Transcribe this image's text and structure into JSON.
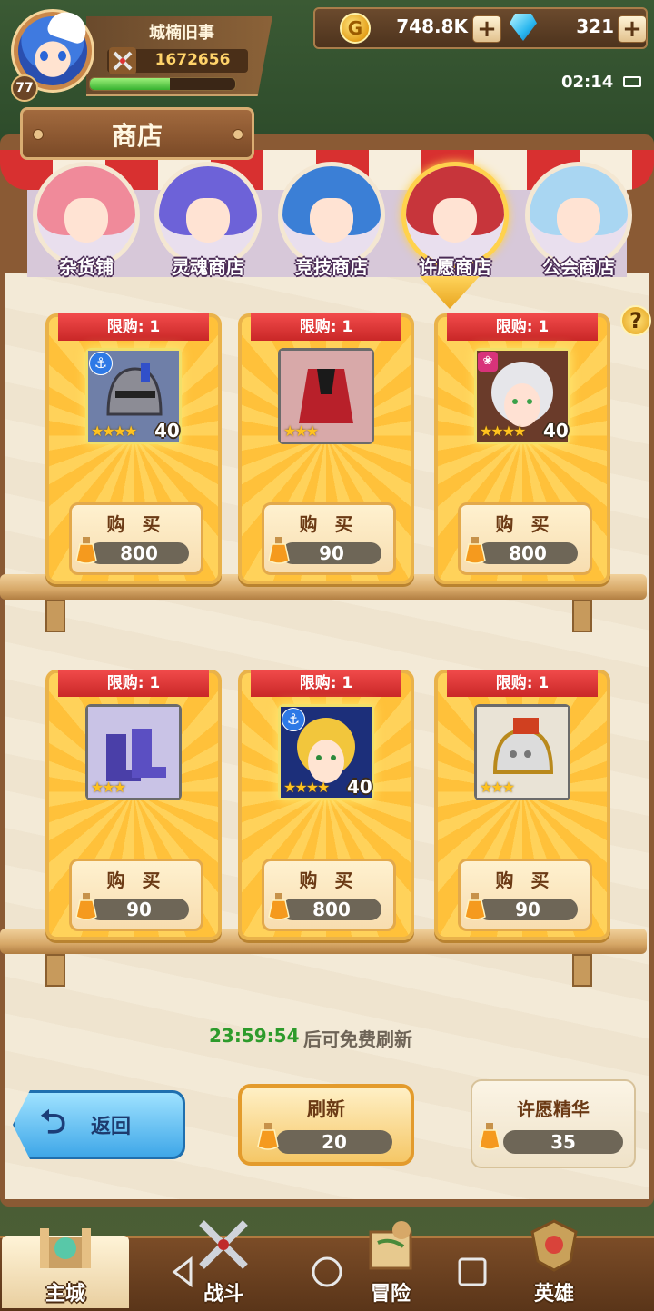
{
  "player": {
    "name": "城楠旧事",
    "power": "1672656",
    "level": "77",
    "exp_fraction": 0.55
  },
  "resources": {
    "gold": "748.8K",
    "gems": "321",
    "add_symbol": "+"
  },
  "status": {
    "time": "02:14"
  },
  "shop": {
    "title": "商店",
    "tabs": [
      {
        "label": "杂货铺",
        "hair_color": "#f08a9a"
      },
      {
        "label": "灵魂商店",
        "hair_color": "#6d62d8"
      },
      {
        "label": "竞技商店",
        "hair_color": "#3b7fd6"
      },
      {
        "label": "许愿商店",
        "hair_color": "#c7353b",
        "active": true
      },
      {
        "label": "公会商店",
        "hair_color": "#a9d6f2"
      }
    ],
    "help": "?",
    "items": [
      {
        "limit": "限购: 1",
        "buy": "购 买",
        "price": "800",
        "stars": "★★★★",
        "level": "40",
        "icon": "knight-helmet-icon",
        "badge": "⚓"
      },
      {
        "limit": "限购: 1",
        "buy": "购 买",
        "price": "90",
        "stars": "★★★",
        "level": "",
        "icon": "red-armor-icon",
        "badge": ""
      },
      {
        "limit": "限购: 1",
        "buy": "购 买",
        "price": "800",
        "stars": "★★★★",
        "level": "40",
        "icon": "white-hair-hero-portrait",
        "badge": "❀"
      },
      {
        "limit": "限购: 1",
        "buy": "购 买",
        "price": "90",
        "stars": "★★★",
        "level": "",
        "icon": "blue-boots-icon",
        "badge": ""
      },
      {
        "limit": "限购: 1",
        "buy": "购 买",
        "price": "800",
        "stars": "★★★★",
        "level": "40",
        "icon": "blonde-hero-portrait",
        "badge": "⚓"
      },
      {
        "limit": "限购: 1",
        "buy": "购 买",
        "price": "90",
        "stars": "★★★",
        "level": "",
        "icon": "silver-helmet-icon",
        "badge": ""
      }
    ],
    "refresh_timer": "23:59:54",
    "refresh_hint": "后可免费刷新",
    "back_label": "返回",
    "refresh_label": "刷新",
    "refresh_cost": "20",
    "essence_label": "许愿精华",
    "essence_count": "35"
  },
  "nav": [
    {
      "label": "主城",
      "active": true
    },
    {
      "label": "战斗"
    },
    {
      "label": "冒险"
    },
    {
      "label": "英雄"
    }
  ],
  "colors": {
    "accent_gold": "#ffd24d",
    "ribbon_red": "#e03a3a",
    "timer_green": "#2d9b2b"
  }
}
